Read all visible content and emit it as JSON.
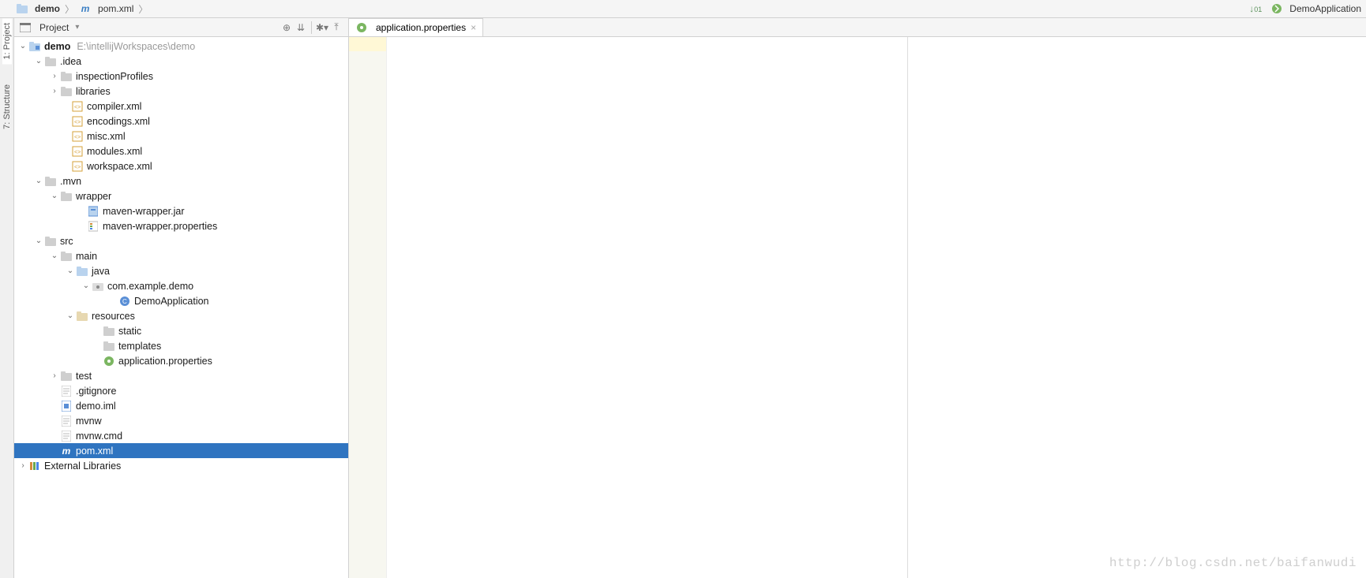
{
  "breadcrumb": {
    "root_label": "demo",
    "file_label": "pom.xml"
  },
  "toolbar_right": {
    "run_config": "DemoApplication"
  },
  "left_rail": {
    "project": "1: Project",
    "structure": "7: Structure"
  },
  "panel": {
    "title": "Project"
  },
  "editor": {
    "tab_label": "application.properties"
  },
  "tree": {
    "root": {
      "name": "demo",
      "path": "E:\\intellijWorkspaces\\demo"
    },
    "external_libs": "External Libraries",
    "idea": {
      "name": ".idea",
      "inspectionProfiles": "inspectionProfiles",
      "libraries": "libraries",
      "compiler": "compiler.xml",
      "encodings": "encodings.xml",
      "misc": "misc.xml",
      "modules": "modules.xml",
      "workspace": "workspace.xml"
    },
    "mvn": {
      "name": ".mvn",
      "wrapper": "wrapper",
      "jar": "maven-wrapper.jar",
      "props": "maven-wrapper.properties"
    },
    "src": {
      "name": "src",
      "main": "main",
      "java": "java",
      "pkg": "com.example.demo",
      "app": "DemoApplication",
      "resources": "resources",
      "static": "static",
      "templates": "templates",
      "appprops": "application.properties",
      "test": "test"
    },
    "files": {
      "gitignore": ".gitignore",
      "iml": "demo.iml",
      "mvnw": "mvnw",
      "mvnwcmd": "mvnw.cmd",
      "pom": "pom.xml"
    }
  },
  "watermark": "http://blog.csdn.net/baifanwudi"
}
